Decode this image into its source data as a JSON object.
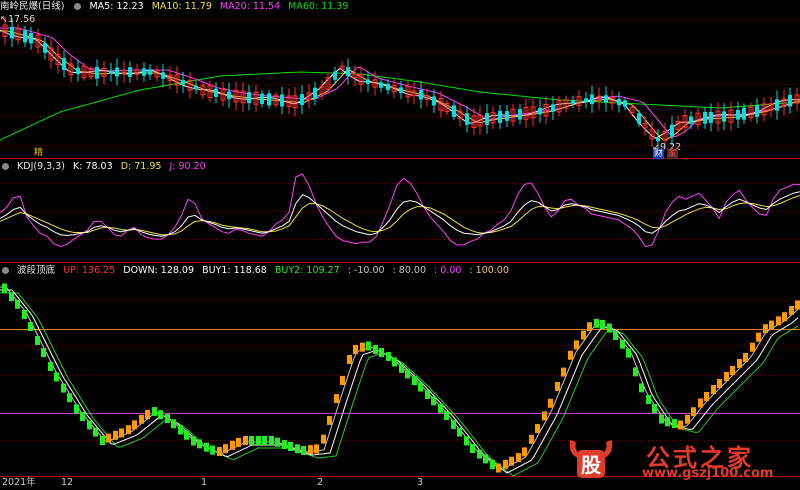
{
  "panels": {
    "price": {
      "title": "南岭民爆(日线)",
      "ma": [
        {
          "label": "MA5: 12.23",
          "color": "#ffffff"
        },
        {
          "label": "MA10: 11.79",
          "color": "#f0e040"
        },
        {
          "label": "MA20: 11.54",
          "color": "#ff40ff"
        },
        {
          "label": "MA60: 11.39",
          "color": "#00e000"
        }
      ],
      "high_label": "17.56",
      "low_label": "9.22",
      "marker_jing": "精",
      "marker_cai": "财",
      "marker_jia": "家"
    },
    "kdj": {
      "title": "KDJ(9,3,3)",
      "k": "K: 78.03",
      "d": "D: 71.95",
      "j": "J: 90.20"
    },
    "wave": {
      "title": "波段顶底",
      "up": "UP: 136.25",
      "down": "DOWN: 128.09",
      "buy1": "BUY1: 118.68",
      "buy2": "BUY2: 109.27",
      "extras": [
        {
          "label": ": -10.00",
          "color": "#c8c8c8"
        },
        {
          "label": ": 80.00",
          "color": "#c8c8c8"
        },
        {
          "label": ": 0.00",
          "color": "#ff40ff"
        },
        {
          "label": ": 100.00",
          "color": "#e8c888"
        }
      ]
    }
  },
  "axis": {
    "dates": [
      "2021年",
      "12",
      "1",
      "2",
      "3"
    ]
  },
  "watermark": {
    "icon_char": "股",
    "cn": "公式之家",
    "url": "www.gszj100.com"
  },
  "colors": {
    "up": "#ff3030",
    "down": "#00e0e0",
    "ma5": "#ffffff",
    "ma10": "#f0e040",
    "ma20": "#ff40ff",
    "ma60": "#00e000",
    "k": "#ffffff",
    "d": "#f0e040",
    "j": "#ff40ff",
    "bar_up": "#ff9900",
    "bar_down": "#22ee22",
    "divider": "#b00000"
  },
  "chart_data": {
    "type": "line",
    "kdj": {
      "k": [
        40,
        45,
        52,
        55,
        45,
        38,
        32,
        28,
        22,
        18,
        17,
        18,
        20,
        22,
        28,
        30,
        28,
        24,
        22,
        24,
        26,
        22,
        19,
        17,
        16,
        18,
        22,
        30,
        42,
        44,
        38,
        35,
        32,
        28,
        26,
        27,
        26,
        24,
        22,
        20,
        22,
        26,
        30,
        36,
        60,
        72,
        68,
        60,
        52,
        44,
        36,
        30,
        26,
        22,
        20,
        18,
        20,
        28,
        38,
        52,
        62,
        64,
        62,
        56,
        50,
        44,
        38,
        30,
        24,
        20,
        19,
        18,
        20,
        22,
        26,
        30,
        36,
        48,
        58,
        64,
        62,
        56,
        50,
        52,
        58,
        60,
        58,
        56,
        52,
        50,
        48,
        46,
        44,
        40,
        36,
        30,
        22,
        20,
        26,
        36,
        44,
        50,
        52,
        56,
        60,
        58,
        54,
        48,
        56,
        62,
        66,
        62,
        58,
        54,
        52,
        60,
        66,
        70,
        74,
        76
      ],
      "d": [
        36,
        40,
        44,
        48,
        46,
        42,
        38,
        34,
        30,
        26,
        23,
        21,
        21,
        21,
        24,
        27,
        28,
        27,
        25,
        24,
        25,
        24,
        22,
        20,
        18,
        18,
        19,
        23,
        30,
        36,
        37,
        36,
        34,
        31,
        29,
        28,
        27,
        26,
        24,
        22,
        22,
        23,
        26,
        30,
        42,
        54,
        60,
        60,
        57,
        52,
        46,
        40,
        35,
        30,
        26,
        23,
        22,
        24,
        28,
        36,
        46,
        52,
        56,
        56,
        54,
        50,
        46,
        40,
        34,
        28,
        24,
        21,
        20,
        21,
        23,
        26,
        29,
        36,
        44,
        52,
        56,
        56,
        54,
        53,
        55,
        57,
        58,
        57,
        55,
        53,
        51,
        49,
        47,
        44,
        41,
        37,
        32,
        28,
        27,
        30,
        35,
        40,
        45,
        49,
        53,
        55,
        54,
        52,
        53,
        57,
        60,
        61,
        60,
        58,
        56,
        57,
        60,
        64,
        68,
        71
      ],
      "j": [
        48,
        55,
        68,
        70,
        42,
        30,
        20,
        16,
        6,
        2,
        5,
        12,
        18,
        24,
        36,
        36,
        28,
        18,
        16,
        24,
        28,
        18,
        14,
        12,
        12,
        18,
        28,
        44,
        66,
        60,
        40,
        33,
        28,
        22,
        20,
        25,
        24,
        20,
        18,
        16,
        22,
        32,
        38,
        48,
        96,
        100,
        84,
        60,
        42,
        28,
        16,
        10,
        8,
        6,
        8,
        8,
        16,
        36,
        58,
        84,
        94,
        88,
        74,
        56,
        42,
        32,
        22,
        10,
        4,
        4,
        9,
        12,
        20,
        24,
        32,
        38,
        50,
        72,
        86,
        88,
        74,
        56,
        42,
        50,
        64,
        66,
        58,
        54,
        46,
        44,
        42,
        40,
        38,
        32,
        26,
        16,
        2,
        4,
        24,
        48,
        62,
        70,
        66,
        70,
        74,
        64,
        54,
        40,
        62,
        72,
        78,
        64,
        54,
        46,
        44,
        66,
        78,
        82,
        86,
        86
      ]
    }
  }
}
